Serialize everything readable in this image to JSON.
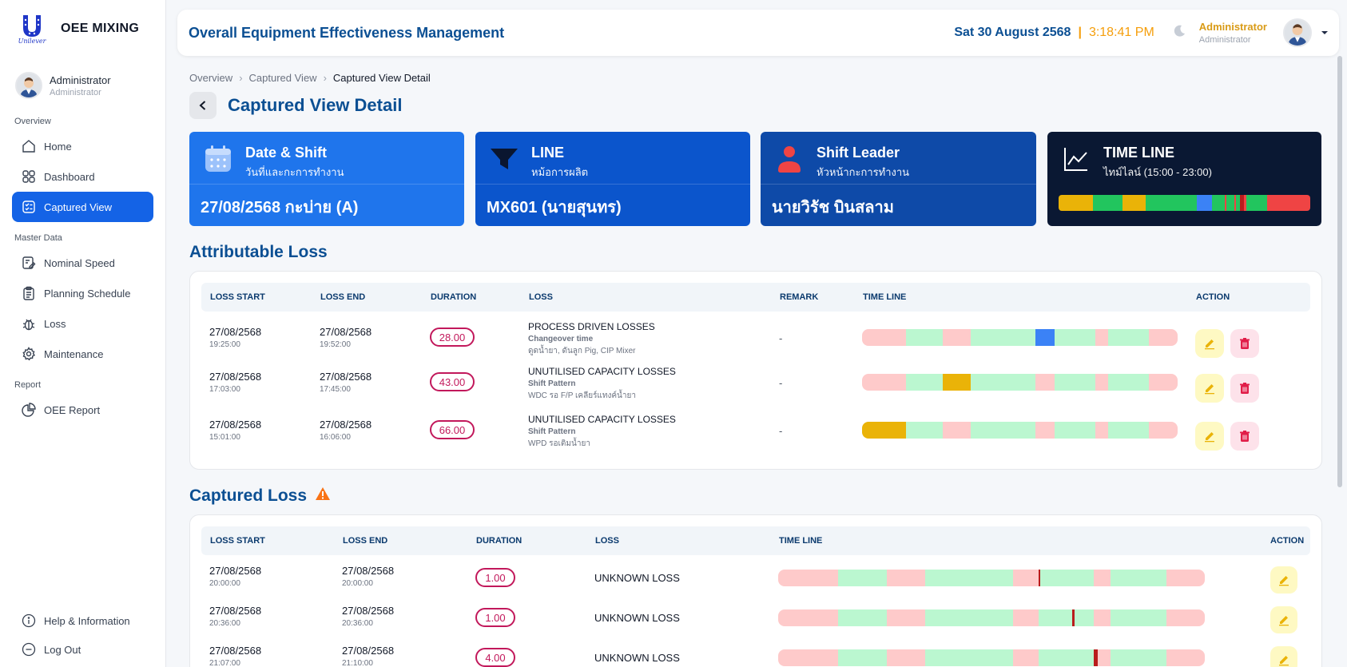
{
  "brand": {
    "logo_text": "Unilever",
    "title": "OEE MIXING"
  },
  "sidebar_user": {
    "name": "Administrator",
    "role": "Administrator"
  },
  "sections": {
    "overview": "Overview",
    "master_data": "Master Data",
    "report": "Report"
  },
  "nav": {
    "home": "Home",
    "dashboard": "Dashboard",
    "captured_view": "Captured View",
    "nominal_speed": "Nominal Speed",
    "planning_schedule": "Planning Schedule",
    "loss": "Loss",
    "maintenance": "Maintenance",
    "oee_report": "OEE Report",
    "help": "Help & Information",
    "logout": "Log Out"
  },
  "header": {
    "title": "Overall Equipment Effectiveness Management",
    "date": "Sat 30 August 2568",
    "separator": "|",
    "time": "3:18:41 PM",
    "user_name": "Administrator",
    "user_role": "Administrator"
  },
  "breadcrumb": {
    "items": [
      "Overview",
      "Captured View",
      "Captured View Detail"
    ]
  },
  "page_title": "Captured View Detail",
  "cards": {
    "date_shift": {
      "title": "Date & Shift",
      "subtitle": "วันที่และกะการทำงาน",
      "value": "27/08/2568 กะบ่าย (A)"
    },
    "line": {
      "title": "LINE",
      "subtitle": "หม้อการผลิต",
      "value": "MX601 (นายสุนทร)"
    },
    "shift_leader": {
      "title": "Shift Leader",
      "subtitle": "หัวหน้ากะการทำงาน",
      "value": "นายวิรัช บินสลาม"
    },
    "timeline": {
      "title": "TIME LINE",
      "subtitle": "ไทม์ไลน์ (15:00 - 23:00)"
    }
  },
  "colors": {
    "green": "#22c55e",
    "yellow": "#eab308",
    "blue": "#3b82f6",
    "red": "#ef4444",
    "light_red": "#fecaca",
    "light_green": "#bbf7d0",
    "dark_red": "#b91c1c"
  },
  "attributable": {
    "title": "Attributable Loss",
    "headers": [
      "LOSS START",
      "LOSS END",
      "DURATION",
      "LOSS",
      "REMARK",
      "TIME LINE",
      "ACTION"
    ],
    "rows": [
      {
        "start_date": "27/08/2568",
        "start_time": "19:25:00",
        "end_date": "27/08/2568",
        "end_time": "19:52:00",
        "duration": "28.00",
        "loss": "PROCESS DRIVEN LOSSES",
        "loss_sub": "Changeover time",
        "loss_note": "ดูดน้ำยา, ดันลูก Pig, CIP Mixer",
        "remark": "-"
      },
      {
        "start_date": "27/08/2568",
        "start_time": "17:03:00",
        "end_date": "27/08/2568",
        "end_time": "17:45:00",
        "duration": "43.00",
        "loss": "UNUTILISED CAPACITY LOSSES",
        "loss_sub": "Shift Pattern",
        "loss_note": "WDC รอ F/P เคลียร์แทงค์น้ำยา",
        "remark": "-"
      },
      {
        "start_date": "27/08/2568",
        "start_time": "15:01:00",
        "end_date": "27/08/2568",
        "end_time": "16:06:00",
        "duration": "66.00",
        "loss": "UNUTILISED CAPACITY LOSSES",
        "loss_sub": "Shift Pattern",
        "loss_note": "WPD รอเติมน้ำยา",
        "remark": "-"
      }
    ]
  },
  "captured": {
    "title": "Captured Loss",
    "headers": [
      "LOSS START",
      "LOSS END",
      "DURATION",
      "LOSS",
      "TIME LINE",
      "ACTION"
    ],
    "rows": [
      {
        "start_date": "27/08/2568",
        "start_time": "20:00:00",
        "end_date": "27/08/2568",
        "end_time": "20:00:00",
        "duration": "1.00",
        "loss": "UNKNOWN LOSS"
      },
      {
        "start_date": "27/08/2568",
        "start_time": "20:36:00",
        "end_date": "27/08/2568",
        "end_time": "20:36:00",
        "duration": "1.00",
        "loss": "UNKNOWN LOSS"
      },
      {
        "start_date": "27/08/2568",
        "start_time": "21:07:00",
        "end_date": "27/08/2568",
        "end_time": "21:10:00",
        "duration": "4.00",
        "loss": "UNKNOWN LOSS"
      }
    ]
  }
}
